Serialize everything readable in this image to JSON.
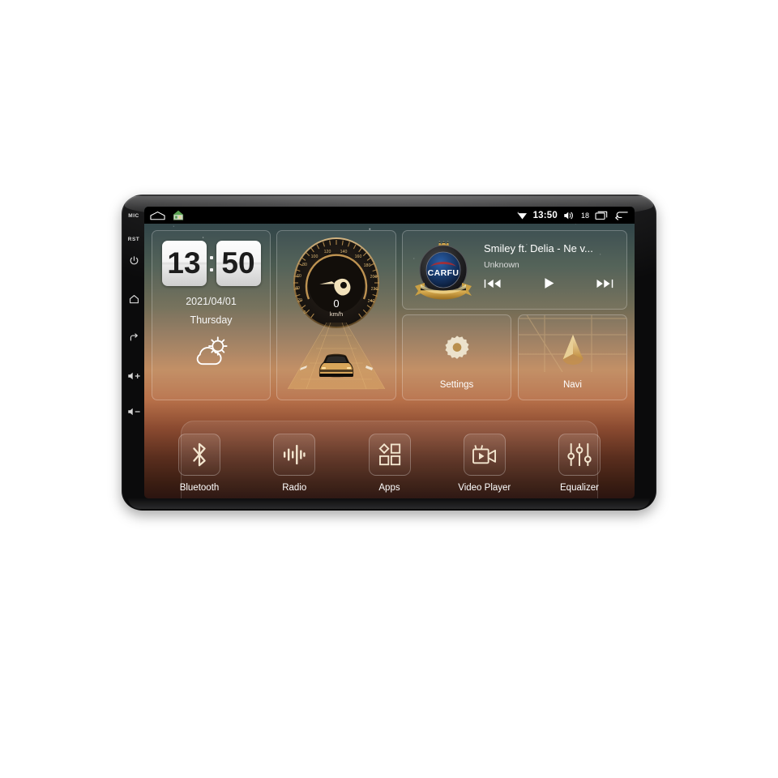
{
  "device": {
    "bezel_buttons": [
      {
        "name": "mic",
        "label": "MIC",
        "type": "text"
      },
      {
        "name": "reset",
        "label": "RST",
        "type": "text"
      },
      {
        "name": "power",
        "label": "power-icon",
        "type": "icon"
      },
      {
        "name": "home",
        "label": "home-icon",
        "type": "icon"
      },
      {
        "name": "back",
        "label": "back-icon",
        "type": "icon"
      },
      {
        "name": "volume-up",
        "label": "volume-up-icon",
        "type": "icon"
      },
      {
        "name": "volume-down",
        "label": "volume-down-icon",
        "type": "icon"
      }
    ]
  },
  "statusbar": {
    "left_icons": [
      "arch-home-icon",
      "green-house-icon"
    ],
    "signal_icon": "wifi-signal-icon",
    "time": "13:50",
    "volume_icon": "volume-icon",
    "volume_level": "18",
    "recents_icon": "recents-icon",
    "back_icon": "back-icon"
  },
  "clock_widget": {
    "hours": "13",
    "minutes": "50",
    "separator": ":",
    "date": "2021/04/01",
    "weekday": "Thursday",
    "weather_icon": "partly-cloudy-icon"
  },
  "speedometer": {
    "value": "0",
    "unit": "km/h",
    "ticks": [
      "0",
      "20",
      "40",
      "60",
      "80",
      "100",
      "120",
      "140",
      "160",
      "180",
      "200",
      "220",
      "240"
    ],
    "min": 0,
    "max": 240,
    "needle_color": "#f0dcae",
    "dial_color": "#c79a55"
  },
  "media": {
    "album_badge": "carfu-badge-logo",
    "badge_text": "CARFU",
    "title": "Smiley ft. Delia - Ne v...",
    "artist": "Unknown",
    "controls": [
      {
        "name": "previous-track",
        "icon": "previous-icon"
      },
      {
        "name": "play",
        "icon": "play-icon"
      },
      {
        "name": "next-track",
        "icon": "next-icon"
      }
    ]
  },
  "tiles": [
    {
      "name": "settings",
      "label": "Settings",
      "icon": "gear-icon"
    },
    {
      "name": "navi",
      "label": "Navi",
      "icon": "navigation-arrow-icon"
    }
  ],
  "dock": [
    {
      "name": "bluetooth",
      "label": "Bluetooth",
      "icon": "bluetooth-icon"
    },
    {
      "name": "radio",
      "label": "Radio",
      "icon": "radio-waves-icon"
    },
    {
      "name": "apps",
      "label": "Apps",
      "icon": "apps-grid-icon"
    },
    {
      "name": "video-player",
      "label": "Video Player",
      "icon": "camcorder-icon"
    },
    {
      "name": "equalizer",
      "label": "Equalizer",
      "icon": "equalizer-sliders-icon"
    }
  ],
  "colors": {
    "accent_gold": "#d8b472",
    "screen_top": "#2b3f45",
    "screen_mid": "#c08a5e",
    "screen_bottom": "#2b1410",
    "statusbar_bg": "#000000"
  }
}
